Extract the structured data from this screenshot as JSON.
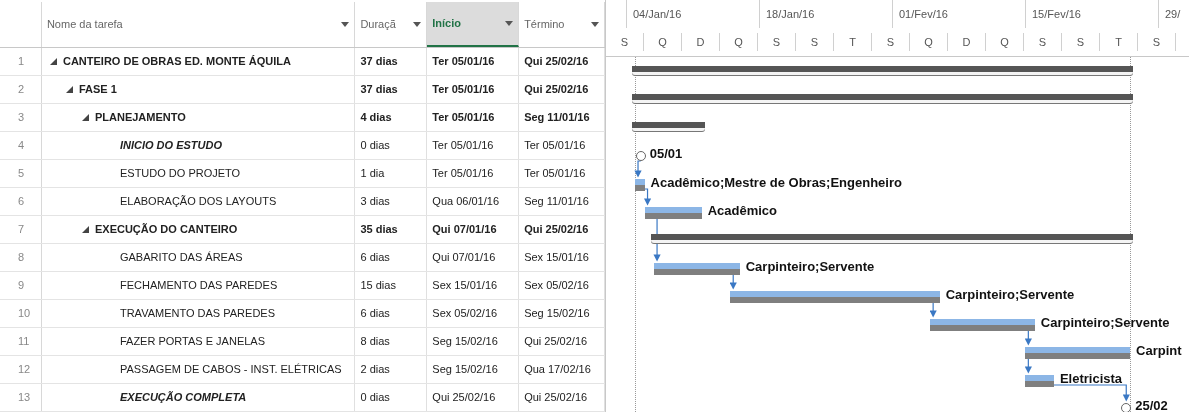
{
  "columns": [
    {
      "label": "Nome da tarefa",
      "selected": false
    },
    {
      "label": "Duraçã",
      "selected": false
    },
    {
      "label": "Início",
      "selected": true
    },
    {
      "label": "Término",
      "selected": false
    }
  ],
  "timescale": {
    "top": [
      "04/Jan/16",
      "18/Jan/16",
      "01/Fev/16",
      "15/Fev/16",
      "29/"
    ],
    "bottom": [
      "S",
      "Q",
      "D",
      "Q",
      "S",
      "S",
      "T",
      "S",
      "Q",
      "D",
      "Q",
      "S",
      "S",
      "T",
      "S"
    ]
  },
  "tasks": [
    {
      "id": "1",
      "name": "CANTEIRO DE OBRAS ED. MONTE ÁQUILA",
      "kind": "summary",
      "expanded": true,
      "duration": "37 dias",
      "start": "Ter 05/01/16",
      "finish": "Qui 25/02/16",
      "children": [
        {
          "id": "2",
          "name": "FASE 1",
          "kind": "summary",
          "expanded": true,
          "duration": "37 dias",
          "start": "Ter 05/01/16",
          "finish": "Qui 25/02/16",
          "children": [
            {
              "id": "3",
              "name": "PLANEJAMENTO",
              "kind": "summary",
              "expanded": true,
              "duration": "4 dias",
              "start": "Ter 05/01/16",
              "finish": "Seg 11/01/16",
              "children": [
                {
                  "id": "4",
                  "name": "INICIO DO ESTUDO",
                  "kind": "milestone",
                  "duration": "0 dias",
                  "start": "Ter 05/01/16",
                  "finish": "Ter 05/01/16",
                  "bar_label": "05/01"
                },
                {
                  "id": "5",
                  "name": "ESTUDO DO PROJETO",
                  "kind": "task",
                  "duration": "1 dia",
                  "start": "Ter 05/01/16",
                  "finish": "Ter 05/01/16",
                  "bar_label": "Acadêmico;Mestre de Obras;Engenheiro"
                },
                {
                  "id": "6",
                  "name": "ELABORAÇÃO DOS LAYOUTS",
                  "kind": "task",
                  "duration": "3 dias",
                  "start": "Qua 06/01/16",
                  "finish": "Seg 11/01/16",
                  "bar_label": "Acadêmico"
                }
              ]
            },
            {
              "id": "7",
              "name": "EXECUÇÃO DO CANTEIRO",
              "kind": "summary",
              "expanded": true,
              "duration": "35 dias",
              "start": "Qui 07/01/16",
              "finish": "Qui 25/02/16",
              "children": [
                {
                  "id": "8",
                  "name": "GABARITO DAS ÁREAS",
                  "kind": "task",
                  "duration": "6 dias",
                  "start": "Qui 07/01/16",
                  "finish": "Sex 15/01/16",
                  "bar_label": "Carpinteiro;Servente"
                },
                {
                  "id": "9",
                  "name": "FECHAMENTO DAS PAREDES",
                  "kind": "task",
                  "duration": "15 dias",
                  "start": "Sex 15/01/16",
                  "finish": "Sex 05/02/16",
                  "bar_label": "Carpinteiro;Servente"
                },
                {
                  "id": "10",
                  "name": "TRAVAMENTO DAS PAREDES",
                  "kind": "task",
                  "duration": "6 dias",
                  "start": "Sex 05/02/16",
                  "finish": "Seg 15/02/16",
                  "bar_label": "Carpinteiro;Servente"
                },
                {
                  "id": "11",
                  "name": "FAZER PORTAS E JANELAS",
                  "kind": "task",
                  "duration": "8 dias",
                  "start": "Seg 15/02/16",
                  "finish": "Qui 25/02/16",
                  "bar_label": "Carpint"
                },
                {
                  "id": "12",
                  "name": "PASSAGEM DE CABOS - INST. ELÉTRICAS",
                  "kind": "task",
                  "duration": "2 dias",
                  "start": "Seg 15/02/16",
                  "finish": "Qua 17/02/16",
                  "bar_label": "Eletricista"
                },
                {
                  "id": "13",
                  "name": "EXECUÇÃO COMPLETA",
                  "kind": "milestone",
                  "duration": "0 dias",
                  "start": "Qui 25/02/16",
                  "finish": "Qui 25/02/16",
                  "bar_label": "25/02"
                }
              ]
            }
          ]
        }
      ]
    }
  ]
}
